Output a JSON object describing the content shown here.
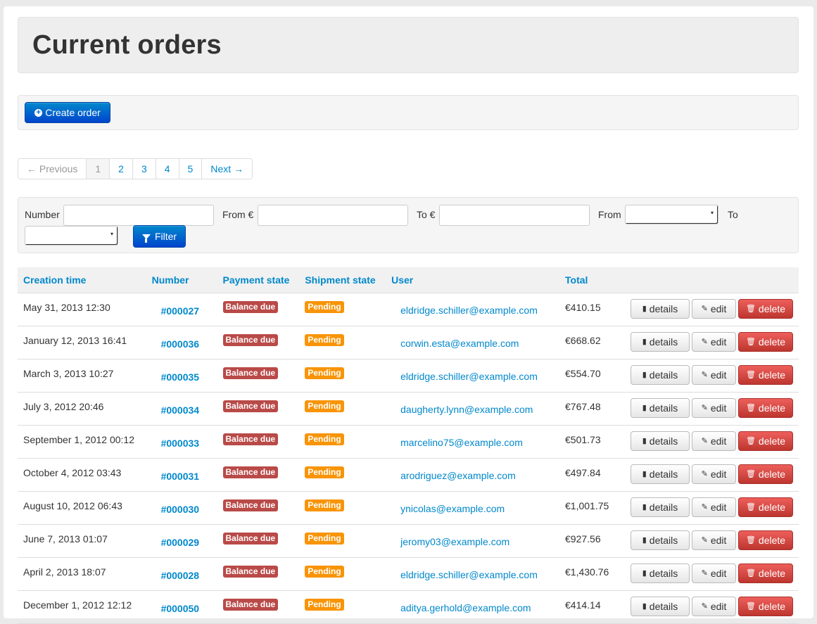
{
  "page": {
    "title": "Current orders"
  },
  "toolbar": {
    "create_label": "Create order"
  },
  "pagination": {
    "prev": "← Previous",
    "pages": [
      "1",
      "2",
      "3",
      "4",
      "5"
    ],
    "next": "Next →",
    "current": "1"
  },
  "filter": {
    "number_label": "Number",
    "from_amount_label": "From €",
    "to_amount_label": "To €",
    "from_date_label": "From",
    "to_date_label": "To",
    "button_label": "Filter"
  },
  "table": {
    "headers": {
      "creation_time": "Creation time",
      "number": "Number",
      "payment_state": "Payment state",
      "shipment_state": "Shipment state",
      "user": "User",
      "total": "Total"
    },
    "action_labels": {
      "details": "details",
      "edit": "edit",
      "delete": "delete"
    },
    "rows": [
      {
        "time": "May 31, 2013 12:30",
        "number": "#000027",
        "payment": "Balance due",
        "shipment": "Pending",
        "user": "eldridge.schiller@example.com",
        "total": "€410.15"
      },
      {
        "time": "January 12, 2013 16:41",
        "number": "#000036",
        "payment": "Balance due",
        "shipment": "Pending",
        "user": "corwin.esta@example.com",
        "total": "€668.62"
      },
      {
        "time": "March 3, 2013 10:27",
        "number": "#000035",
        "payment": "Balance due",
        "shipment": "Pending",
        "user": "eldridge.schiller@example.com",
        "total": "€554.70"
      },
      {
        "time": "July 3, 2012 20:46",
        "number": "#000034",
        "payment": "Balance due",
        "shipment": "Pending",
        "user": "daugherty.lynn@example.com",
        "total": "€767.48"
      },
      {
        "time": "September 1, 2012 00:12",
        "number": "#000033",
        "payment": "Balance due",
        "shipment": "Pending",
        "user": "marcelino75@example.com",
        "total": "€501.73"
      },
      {
        "time": "October 4, 2012 03:43",
        "number": "#000031",
        "payment": "Balance due",
        "shipment": "Pending",
        "user": "arodriguez@example.com",
        "total": "€497.84"
      },
      {
        "time": "August 10, 2012 06:43",
        "number": "#000030",
        "payment": "Balance due",
        "shipment": "Pending",
        "user": "ynicolas@example.com",
        "total": "€1,001.75"
      },
      {
        "time": "June 7, 2013 01:07",
        "number": "#000029",
        "payment": "Balance due",
        "shipment": "Pending",
        "user": "jeromy03@example.com",
        "total": "€927.56"
      },
      {
        "time": "April 2, 2013 18:07",
        "number": "#000028",
        "payment": "Balance due",
        "shipment": "Pending",
        "user": "eldridge.schiller@example.com",
        "total": "€1,430.76"
      },
      {
        "time": "December 1, 2012 12:12",
        "number": "#000050",
        "payment": "Balance due",
        "shipment": "Pending",
        "user": "aditya.gerhold@example.com",
        "total": "€414.14"
      }
    ]
  },
  "colors": {
    "link": "#0088cc",
    "primary": "#0055cc",
    "danger": "#bd362f",
    "label_important": "#b94a48",
    "label_warning": "#f89406"
  },
  "icons": {
    "create": "circle-plus-icon",
    "filter": "filter-icon",
    "details": "book-icon",
    "edit": "pencil-icon",
    "delete": "trash-icon"
  }
}
